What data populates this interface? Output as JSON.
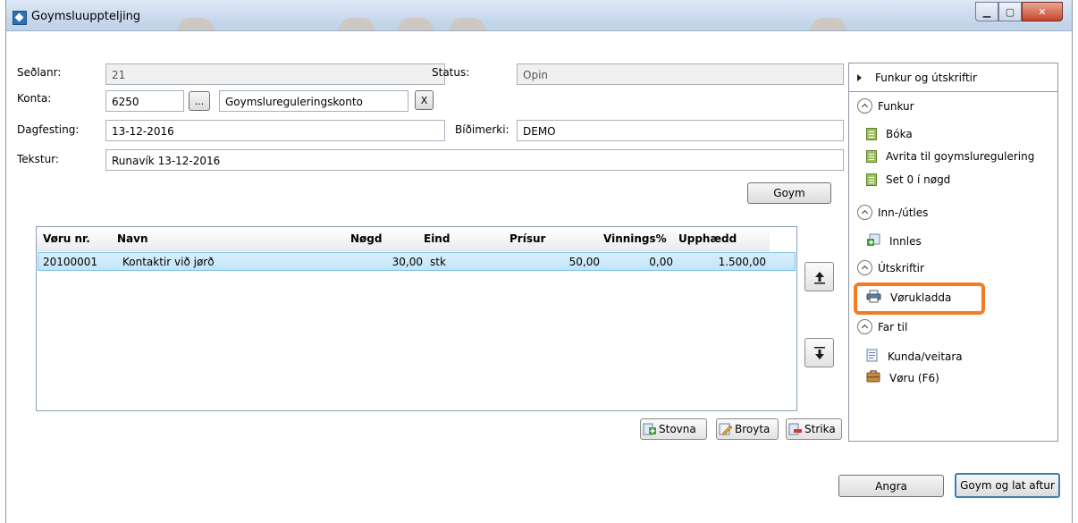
{
  "window": {
    "title": "Goymsluuppteljing"
  },
  "form": {
    "sedlanr": {
      "label": "Seðlanr:",
      "value": "21"
    },
    "status": {
      "label": "Status:",
      "value": "Opin"
    },
    "konta": {
      "label": "Konta:",
      "value": "6250",
      "browse_label": "...",
      "name_value": "Goymslureguleringskonto",
      "clear_label": "X"
    },
    "dagfesting": {
      "label": "Dagfesting:",
      "value": "13-12-2016"
    },
    "bidimerki": {
      "label": "Bíðimerki:",
      "value": "DEMO"
    },
    "tekstur": {
      "label": "Tekstur:",
      "value": "Runavík 13-12-2016"
    },
    "save_label": "Goym"
  },
  "grid": {
    "columns": [
      "Vøru nr.",
      "Navn",
      "Nøgd",
      "Eind",
      "Prísur",
      "Vinnings%",
      "Upphædd"
    ],
    "rows": [
      {
        "voru_nr": "20100001",
        "navn": "Kontaktir við jørð",
        "nogd": "30,00",
        "eind": "stk",
        "prisur": "50,00",
        "vinnings": "0,00",
        "upphaedd": "1.500,00"
      }
    ]
  },
  "grid_buttons": {
    "new": "Stovna",
    "edit": "Broyta",
    "delete": "Strika"
  },
  "panel": {
    "header": "Funkur og útskriftir",
    "sections": [
      {
        "title": "Funkur",
        "items": [
          "Bóka",
          "Avrita til goymsluregulering",
          "Set 0 í nøgd"
        ]
      },
      {
        "title": "Inn-/útles",
        "items": [
          "Innles"
        ]
      },
      {
        "title": "Útskriftir",
        "items": [
          "Vørukladda"
        ]
      },
      {
        "title": "Far til",
        "items": [
          "Kunda/veitara",
          "Vøru (F6)"
        ]
      }
    ]
  },
  "footer": {
    "cancel": "Angra",
    "save_close": "Goym og lat aftur"
  },
  "colors": {
    "highlight": "#f47b20",
    "selected_row": "#c2e4f8",
    "accent_border": "#3c7fb1"
  }
}
